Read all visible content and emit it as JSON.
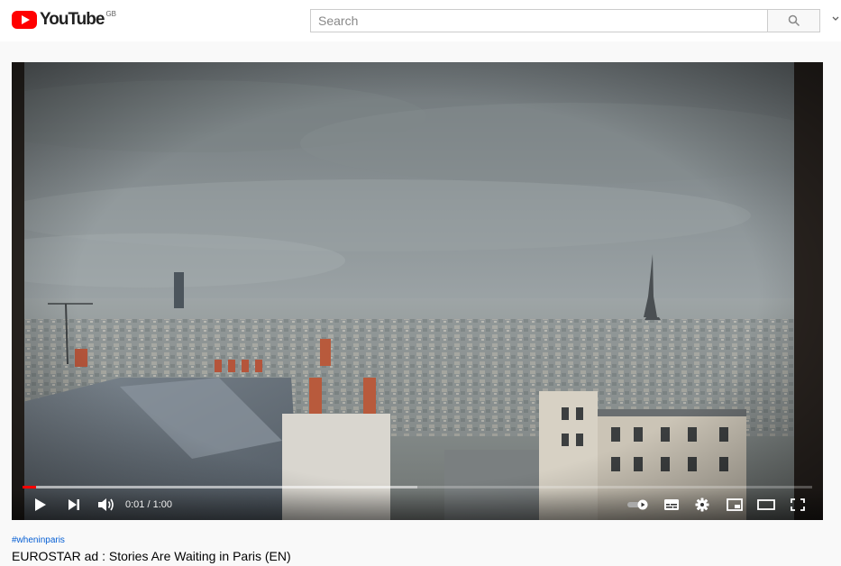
{
  "header": {
    "logo_text": "YouTube",
    "country_code": "GB",
    "search_placeholder": "Search",
    "search_value": ""
  },
  "player": {
    "time_display": "0:01 / 1:00",
    "progress_played": 0.017,
    "progress_loaded": 0.5
  },
  "video": {
    "hashtag": "#wheninparis",
    "title": "EUROSTAR ad : Stories Are Waiting in Paris (EN)"
  },
  "colors": {
    "brand_red": "#ff0000",
    "hashtag_blue": "#065fd4"
  }
}
